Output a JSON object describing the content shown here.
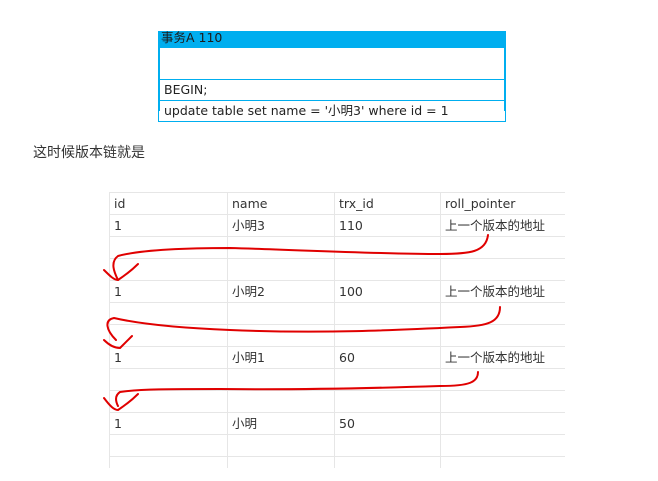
{
  "transaction": {
    "header": "事务A 110",
    "lines": [
      "BEGIN;",
      "update table set name = '小明3'  where id = 1"
    ]
  },
  "caption": "这时候版本链就是",
  "version_table": {
    "columns": [
      "id",
      "name",
      "trx_id",
      "roll_pointer"
    ],
    "rows": [
      [
        "1",
        "小明3",
        "110",
        "上一个版本的地址"
      ],
      [
        "1",
        "小明2",
        "100",
        "上一个版本的地址"
      ],
      [
        "1",
        "小明1",
        "60",
        "上一个版本的地址"
      ],
      [
        "1",
        "小明",
        "50",
        ""
      ]
    ]
  },
  "colors": {
    "accent": "#00aeef",
    "annotation": "#e00000"
  }
}
